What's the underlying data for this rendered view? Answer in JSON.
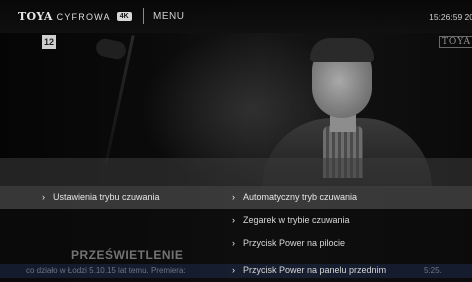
{
  "topbar": {
    "brand": "TOYA",
    "sub": "CYFROWA",
    "badge": "4K",
    "menu_title": "MENU",
    "clock": "15:26:59 20"
  },
  "channel": {
    "age_rating": "12",
    "watermark": "TOYA"
  },
  "menu": {
    "left_item": "Ustawienia trybu czuwania",
    "right_items": [
      "Automatyczny tryb czuwania",
      "Zegarek w trybie czuwania",
      "Przycisk Power na pilocie",
      "Przycisk Power na panelu przednim"
    ],
    "chevron": "›"
  },
  "program": {
    "title": "PRZEŚWIETLENIE",
    "ticker": "co działo w Łodzi 5.10.15 lat temu. Premiera:",
    "ticker_tail": "5:25."
  },
  "icons": {
    "chevron": "chevron-right-icon"
  },
  "colors": {
    "selected_row": "#787878",
    "text": "#e6e6e6"
  }
}
